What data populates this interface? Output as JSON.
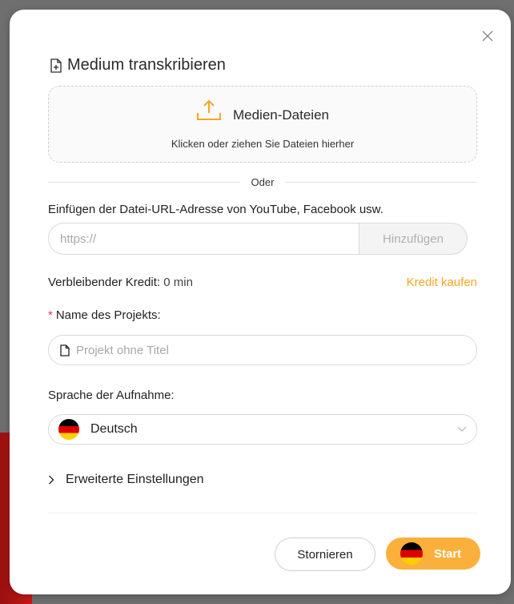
{
  "dialog": {
    "title": "Medium transkribieren",
    "close_icon": "close-icon",
    "title_icon": "file-plus-icon"
  },
  "dropzone": {
    "icon": "upload-icon",
    "title": "Medien-Dateien",
    "subtitle": "Klicken oder ziehen Sie Dateien hierher"
  },
  "divider": {
    "text": "Oder"
  },
  "url": {
    "label": "Einfügen der Datei-URL-Adresse von YouTube, Facebook usw.",
    "placeholder": "https://",
    "value": "",
    "add_label": "Hinzufügen"
  },
  "credit": {
    "label": "Verbleibender Kredit:",
    "value": " 0 min",
    "buy_label": "Kredit kaufen"
  },
  "project": {
    "required_mark": "*",
    "label": "Name des Projekts:",
    "placeholder": "Projekt ohne Titel",
    "value": "",
    "icon": "file-icon"
  },
  "language": {
    "label": "Sprache der Aufnahme:",
    "selected": "Deutsch",
    "flag": "germany-flag-icon",
    "chevron": "chevron-down-icon"
  },
  "advanced": {
    "label": "Erweiterte Einstellungen",
    "icon": "chevron-right-icon"
  },
  "footer": {
    "cancel_label": "Stornieren",
    "start_label": "Start"
  },
  "colors": {
    "accent": "#fbb03b",
    "link": "#f5a623",
    "required": "#e0394c",
    "backdrop": "#6f6f6f"
  }
}
